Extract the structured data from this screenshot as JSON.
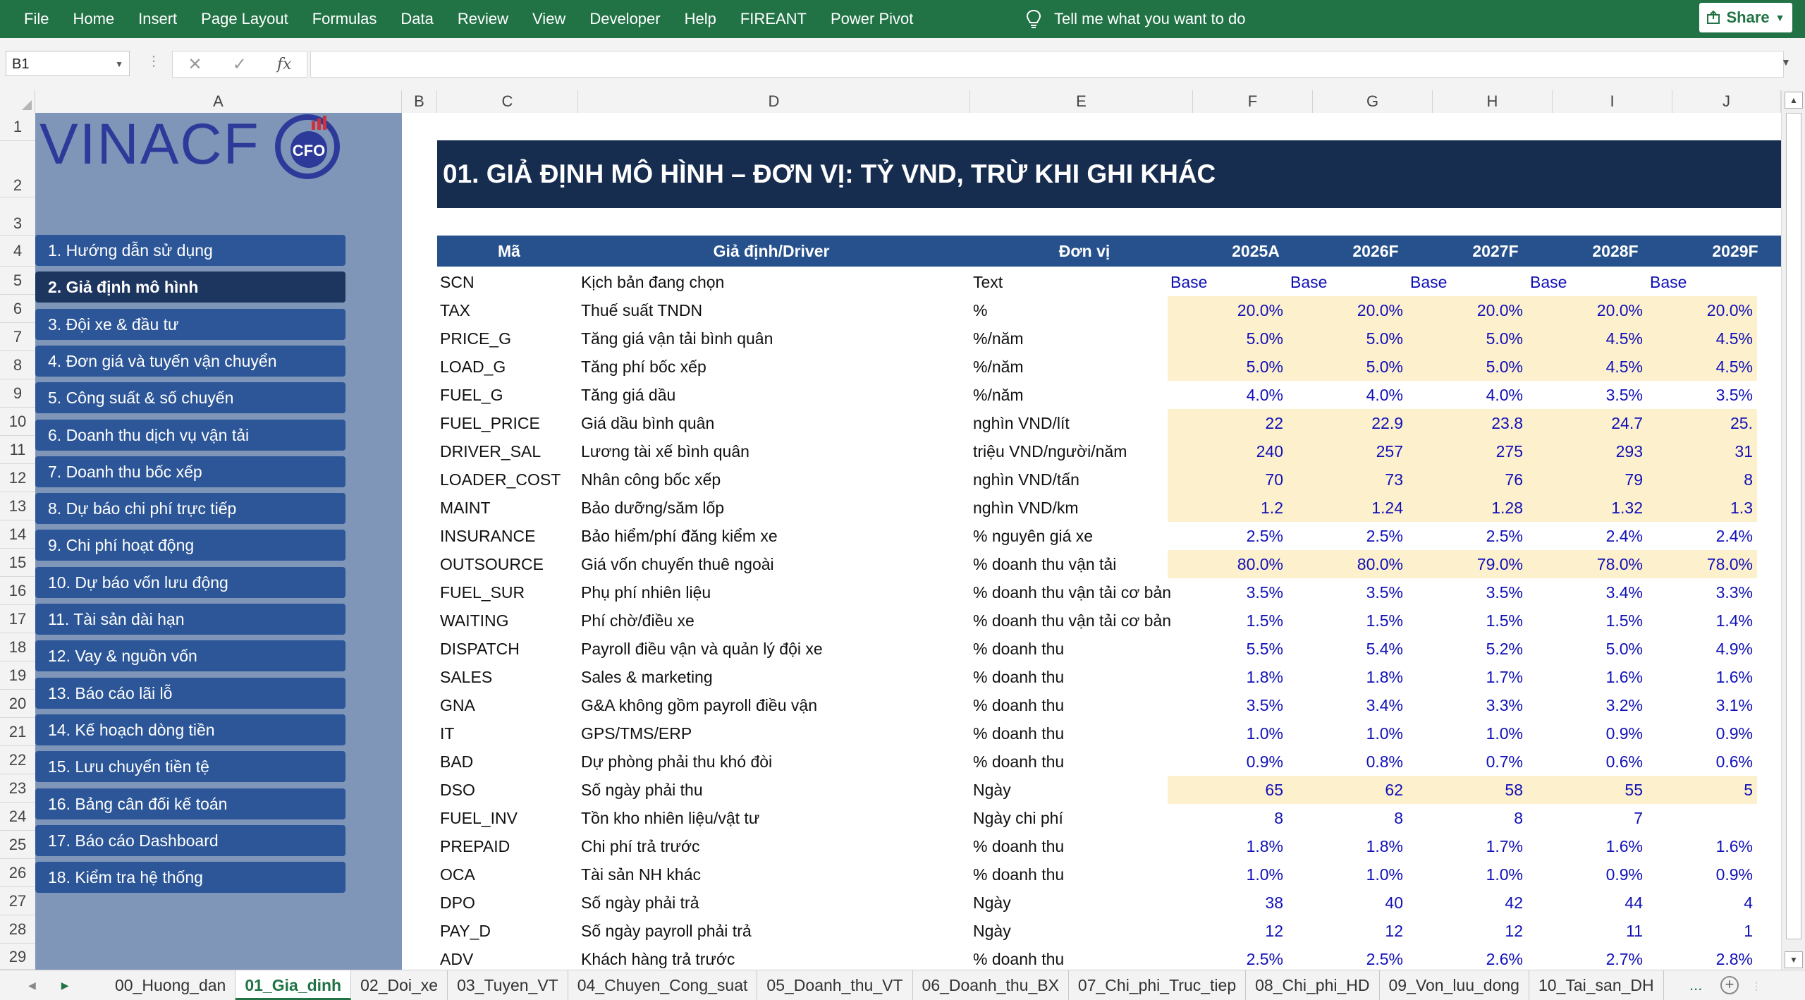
{
  "ribbon": {
    "menu": [
      "File",
      "Home",
      "Insert",
      "Page Layout",
      "Formulas",
      "Data",
      "Review",
      "View",
      "Developer",
      "Help",
      "FIREANT",
      "Power Pivot"
    ],
    "tell_me": "Tell me what you want to do",
    "share": "Share"
  },
  "formula_bar": {
    "name_box": "B1",
    "fx": "fx",
    "content": ""
  },
  "columns": [
    "A",
    "B",
    "C",
    "D",
    "E",
    "F",
    "G",
    "H",
    "I",
    "J"
  ],
  "rows": [
    "1",
    "2",
    "3",
    "4",
    "5",
    "6",
    "7",
    "8",
    "9",
    "10",
    "11",
    "12",
    "13",
    "14",
    "15",
    "16",
    "17",
    "18",
    "19",
    "20",
    "21",
    "22",
    "23",
    "24",
    "25",
    "26",
    "27",
    "28",
    "29"
  ],
  "sidebar": {
    "logo_text": "VINACF",
    "logo_badge": "CFO",
    "nav": [
      "1. Hướng dẫn sử dụng",
      "2. Giả định mô hình",
      "3. Đội xe & đầu tư",
      "4. Đơn giá và tuyến vận chuyển",
      "5. Công suất & số chuyến",
      "6. Doanh thu dịch vụ vận tải",
      "7. Doanh thu bốc xếp",
      "8. Dự báo chi phí trực tiếp",
      "9. Chi phí hoạt động",
      "10. Dự báo vốn lưu động",
      "11. Tài sản dài hạn",
      "12. Vay & nguồn vốn",
      "13. Báo cáo lãi lỗ",
      "14. Kế hoạch dòng tiền",
      "15. Lưu chuyển tiền tệ",
      "16. Bảng cân đối kế toán",
      "17. Báo cáo Dashboard",
      "18. Kiểm tra hệ thống"
    ],
    "active_index": 1
  },
  "sheet": {
    "title": "01. GIẢ ĐỊNH MÔ HÌNH – ĐƠN VỊ: TỶ VND, TRỪ KHI GHI KHÁC",
    "headers": {
      "code": "Mã",
      "driver": "Giả định/Driver",
      "unit": "Đơn vị",
      "years": [
        "2025A",
        "2026F",
        "2027F",
        "2028F",
        "2029F"
      ]
    },
    "rows": [
      {
        "code": "SCN",
        "driver": "Kịch bản đang chọn",
        "unit": "Text",
        "values": [
          "Base",
          "Base",
          "Base",
          "Base",
          "Base"
        ],
        "text": true,
        "input": false
      },
      {
        "code": "TAX",
        "driver": "Thuế suất TNDN",
        "unit": "%",
        "values": [
          "20.0%",
          "20.0%",
          "20.0%",
          "20.0%",
          "20.0%"
        ],
        "input": true
      },
      {
        "code": "PRICE_G",
        "driver": "Tăng giá vận tải bình quân",
        "unit": "%/năm",
        "values": [
          "5.0%",
          "5.0%",
          "5.0%",
          "4.5%",
          "4.5%"
        ],
        "input": true
      },
      {
        "code": "LOAD_G",
        "driver": "Tăng phí bốc xếp",
        "unit": "%/năm",
        "values": [
          "5.0%",
          "5.0%",
          "5.0%",
          "4.5%",
          "4.5%"
        ],
        "input": true
      },
      {
        "code": "FUEL_G",
        "driver": "Tăng giá dầu",
        "unit": "%/năm",
        "values": [
          "4.0%",
          "4.0%",
          "4.0%",
          "3.5%",
          "3.5%"
        ],
        "input": false
      },
      {
        "code": "FUEL_PRICE",
        "driver": "Giá dầu bình quân",
        "unit": "nghìn VND/lít",
        "values": [
          "22",
          "22.9",
          "23.8",
          "24.7",
          "25."
        ],
        "input": true
      },
      {
        "code": "DRIVER_SAL",
        "driver": "Lương tài xế bình quân",
        "unit": "triệu VND/người/năm",
        "values": [
          "240",
          "257",
          "275",
          "293",
          "31"
        ],
        "input": true
      },
      {
        "code": "LOADER_COST",
        "driver": "Nhân công bốc xếp",
        "unit": "nghìn VND/tấn",
        "values": [
          "70",
          "73",
          "76",
          "79",
          "8"
        ],
        "input": true
      },
      {
        "code": "MAINT",
        "driver": "Bảo dưỡng/săm lốp",
        "unit": "nghìn VND/km",
        "values": [
          "1.2",
          "1.24",
          "1.28",
          "1.32",
          "1.3"
        ],
        "input": true
      },
      {
        "code": "INSURANCE",
        "driver": "Bảo hiểm/phí đăng kiểm xe",
        "unit": "% nguyên giá xe",
        "values": [
          "2.5%",
          "2.5%",
          "2.5%",
          "2.4%",
          "2.4%"
        ],
        "input": false
      },
      {
        "code": "OUTSOURCE",
        "driver": "Giá vốn chuyến thuê ngoài",
        "unit": "% doanh thu vận tải",
        "values": [
          "80.0%",
          "80.0%",
          "79.0%",
          "78.0%",
          "78.0%"
        ],
        "input": true
      },
      {
        "code": "FUEL_SUR",
        "driver": "Phụ phí nhiên liệu",
        "unit": "% doanh thu vận tải cơ bản",
        "values": [
          "3.5%",
          "3.5%",
          "3.5%",
          "3.4%",
          "3.3%"
        ],
        "input": false
      },
      {
        "code": "WAITING",
        "driver": "Phí chờ/điều xe",
        "unit": "% doanh thu vận tải cơ bản",
        "values": [
          "1.5%",
          "1.5%",
          "1.5%",
          "1.5%",
          "1.4%"
        ],
        "input": false
      },
      {
        "code": "DISPATCH",
        "driver": "Payroll điều vận và quản lý đội xe",
        "unit": "% doanh thu",
        "values": [
          "5.5%",
          "5.4%",
          "5.2%",
          "5.0%",
          "4.9%"
        ],
        "input": false
      },
      {
        "code": "SALES",
        "driver": "Sales & marketing",
        "unit": "% doanh thu",
        "values": [
          "1.8%",
          "1.8%",
          "1.7%",
          "1.6%",
          "1.6%"
        ],
        "input": false
      },
      {
        "code": "GNA",
        "driver": "G&A không gồm payroll điều vận",
        "unit": "% doanh thu",
        "values": [
          "3.5%",
          "3.4%",
          "3.3%",
          "3.2%",
          "3.1%"
        ],
        "input": false
      },
      {
        "code": "IT",
        "driver": "GPS/TMS/ERP",
        "unit": "% doanh thu",
        "values": [
          "1.0%",
          "1.0%",
          "1.0%",
          "0.9%",
          "0.9%"
        ],
        "input": false
      },
      {
        "code": "BAD",
        "driver": "Dự phòng phải thu khó đòi",
        "unit": "% doanh thu",
        "values": [
          "0.9%",
          "0.8%",
          "0.7%",
          "0.6%",
          "0.6%"
        ],
        "input": false
      },
      {
        "code": "DSO",
        "driver": "Số ngày phải thu",
        "unit": "Ngày",
        "values": [
          "65",
          "62",
          "58",
          "55",
          "5"
        ],
        "input": true
      },
      {
        "code": "FUEL_INV",
        "driver": "Tồn kho nhiên liệu/vật tư",
        "unit": "Ngày chi phí",
        "values": [
          "8",
          "8",
          "8",
          "7",
          ""
        ],
        "input": false
      },
      {
        "code": "PREPAID",
        "driver": "Chi phí trả trước",
        "unit": "% doanh thu",
        "values": [
          "1.8%",
          "1.8%",
          "1.7%",
          "1.6%",
          "1.6%"
        ],
        "input": false
      },
      {
        "code": "OCA",
        "driver": "Tài sản NH khác",
        "unit": "% doanh thu",
        "values": [
          "1.0%",
          "1.0%",
          "1.0%",
          "0.9%",
          "0.9%"
        ],
        "input": false
      },
      {
        "code": "DPO",
        "driver": "Số ngày phải trả",
        "unit": "Ngày",
        "values": [
          "38",
          "40",
          "42",
          "44",
          "4"
        ],
        "input": false
      },
      {
        "code": "PAY_D",
        "driver": "Số ngày payroll phải trả",
        "unit": "Ngày",
        "values": [
          "12",
          "12",
          "12",
          "11",
          "1"
        ],
        "input": false
      },
      {
        "code": "ADV",
        "driver": "Khách hàng trả trước",
        "unit": "% doanh thu",
        "values": [
          "2.5%",
          "2.5%",
          "2.6%",
          "2.7%",
          "2.8%"
        ],
        "input": false
      }
    ]
  },
  "tabs": [
    "00_Huong_dan",
    "01_Gia_dinh",
    "02_Doi_xe",
    "03_Tuyen_VT",
    "04_Chuyen_Cong_suat",
    "05_Doanh_thu_VT",
    "06_Doanh_thu_BX",
    "07_Chi_phi_Truc_tiep",
    "08_Chi_phi_HD",
    "09_Von_luu_dong",
    "10_Tai_san_DH"
  ],
  "active_tab": 1,
  "tab_more": "...",
  "colors": {
    "ribbon": "#217346",
    "sidebar_bg": "#7f96b8",
    "nav_btn": "#2c5697",
    "nav_active": "#1d3660",
    "title_bar": "#172d50",
    "header_row": "#26518c",
    "input_fill": "#fdf0cd",
    "value_text": "#1010b8"
  }
}
